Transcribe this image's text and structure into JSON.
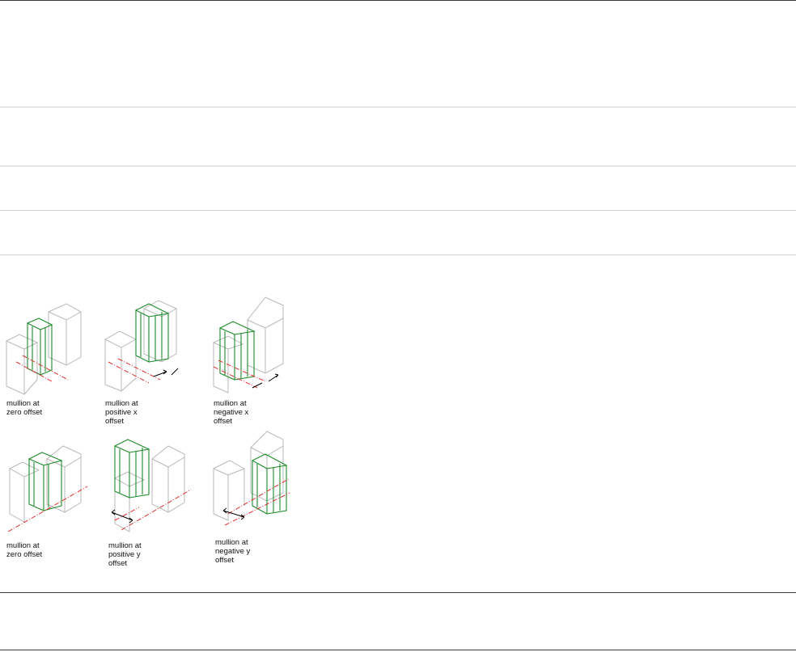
{
  "figure": {
    "panels": [
      {
        "caption": "mullion at\nzero offset",
        "icon": "mullion-zero-offset"
      },
      {
        "caption": "mullion at\npositive x\noffset",
        "icon": "mullion-positive-x-offset"
      },
      {
        "caption": "mullion at\nnegative x\noffset",
        "icon": "mullion-negative-x-offset"
      },
      {
        "caption": "mullion at\nzero offset",
        "icon": "mullion-zero-offset"
      },
      {
        "caption": "mullion at\npositive y\noffset",
        "icon": "mullion-positive-y-offset"
      },
      {
        "caption": "mullion at\nnegative y\noffset",
        "icon": "mullion-negative-y-offset"
      }
    ]
  },
  "colors": {
    "mullion": "#1e8a2a",
    "infill": "#b8b8b8",
    "baseline": "#e03030",
    "dimension": "#000000",
    "rule_light": "#cfcfcf",
    "rule_dark": "#3a3a3a"
  }
}
